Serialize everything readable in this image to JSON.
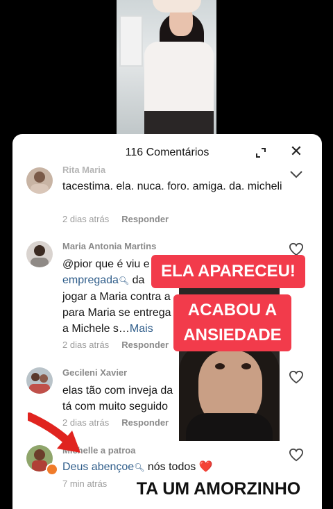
{
  "header": {
    "title": "116 Comentários"
  },
  "comments": [
    {
      "name": "Rita Maria",
      "text": "tacestima. ela. nuca. foro. amiga. da. micheli",
      "time": "2 dias atrás",
      "reply": "Responder"
    },
    {
      "name": "Maria Antonia  Martins",
      "line1": "@pior que é viu e",
      "link": "empregada",
      "line2_rest": " da",
      "line3": "jogar a Maria contra a",
      "line4": "para Maria se entrega",
      "line5": "a Michele s…",
      "more": "Mais",
      "time": "2 dias atrás",
      "reply": "Responder"
    },
    {
      "name": "Gecileni Xavier",
      "line1": "elas tão com inveja da",
      "line2": "tá com muito seguido",
      "time": "2 dias atrás",
      "reply": "Responder"
    },
    {
      "name": "Michelle a patroa",
      "link": "Deus abençoe",
      "rest": " nós todos ❤️",
      "time": "7 min atrás"
    }
  ],
  "stickers": {
    "top": "ELA APARECEU!",
    "middle_line1": "ACABOU A",
    "middle_line2": "ANSIEDADE"
  },
  "bottom_caption": "TA UM AMORZINHO",
  "colors": {
    "sticker_red": "#f23b4b",
    "link_blue": "#2f5d8a",
    "arrow_red": "#e0241f"
  }
}
